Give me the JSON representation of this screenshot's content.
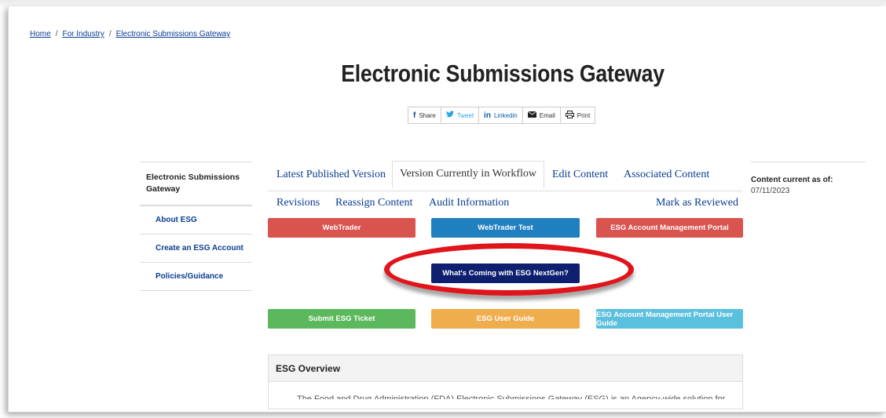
{
  "breadcrumb": {
    "home": "Home",
    "industry": "For Industry",
    "current": "Electronic Submissions Gateway",
    "separator": "/"
  },
  "page_title": "Electronic Submissions Gateway",
  "share": {
    "share": "Share",
    "tweet": "Tweet",
    "linkedin": "Linkedin",
    "email": "Email",
    "print": "Print",
    "icons": {
      "share": "facebook-icon",
      "tweet": "twitter-icon",
      "linkedin": "linkedin-icon",
      "email": "envelope-icon",
      "print": "printer-icon"
    }
  },
  "sidebar": {
    "heading": "Electronic Submissions Gateway",
    "items": [
      {
        "label": "About ESG"
      },
      {
        "label": "Create an ESG Account"
      },
      {
        "label": "Policies/Guidance"
      }
    ]
  },
  "tabs": {
    "latest": "Latest Published Version",
    "workflow": "Version Currently in Workflow",
    "edit": "Edit Content",
    "associated": "Associated Content",
    "revisions": "Revisions",
    "reassign": "Reassign Content",
    "audit": "Audit Information",
    "reviewed": "Mark as Reviewed"
  },
  "buttons": {
    "webtrader": {
      "label": "WebTrader",
      "color": "#d9534f"
    },
    "webtrader_test": {
      "label": "WebTrader Test",
      "color": "#1f7fbf"
    },
    "portal": {
      "label": "ESG Account Management Portal",
      "color": "#d9534f"
    },
    "nextgen": {
      "label": "What's Coming with ESG NextGen?",
      "color": "#0d1f6e"
    },
    "ticket": {
      "label": "Submit ESG Ticket",
      "color": "#5cb85c"
    },
    "guide": {
      "label": "ESG User Guide",
      "color": "#f0ad4e"
    },
    "portal_guide": {
      "label": "ESG Account Management Portal User Guide",
      "color": "#5bc0de"
    }
  },
  "highlight_color": "#e0141a",
  "overview": {
    "title": "ESG Overview",
    "text": "The Food and Drug Administration (FDA) Electronic Submissions Gateway (ESG) is an Agency-wide solution for"
  },
  "content_current": {
    "label": "Content current as of:",
    "date": "07/11/2023"
  }
}
